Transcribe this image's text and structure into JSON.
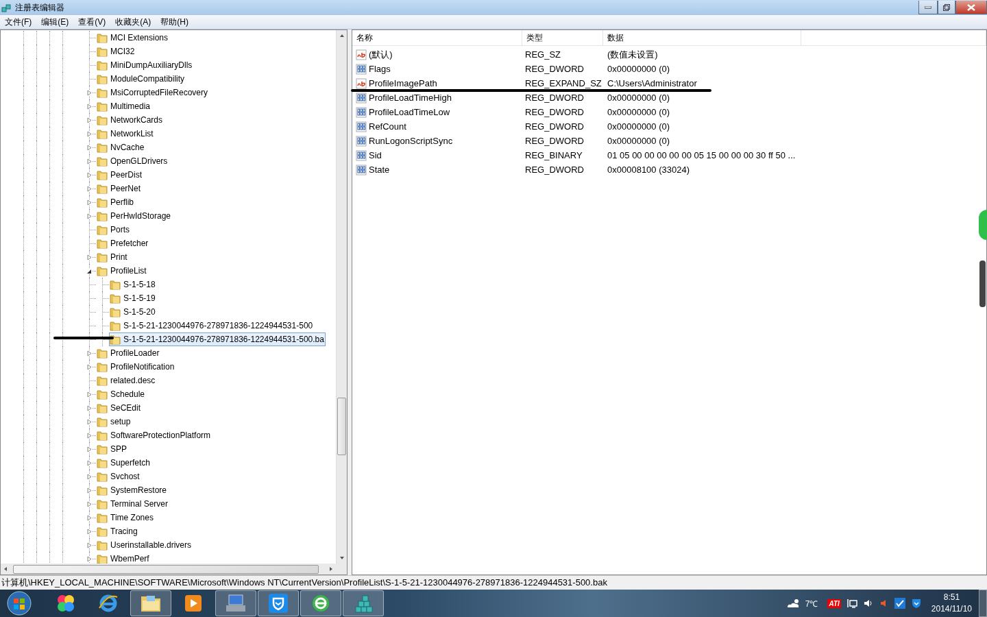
{
  "window": {
    "title": "注册表编辑器"
  },
  "menu": [
    "文件(F)",
    "编辑(E)",
    "查看(V)",
    "收藏夹(A)",
    "帮助(H)"
  ],
  "tree": [
    {
      "label": "MCI Extensions",
      "selected": false
    },
    {
      "label": "MCI32",
      "selected": false
    },
    {
      "label": "MiniDumpAuxiliaryDlls",
      "selected": false
    },
    {
      "label": "ModuleCompatibility",
      "selected": false
    },
    {
      "label": "MsiCorruptedFileRecovery",
      "expanded": false,
      "selected": false
    },
    {
      "label": "Multimedia",
      "expanded": false,
      "selected": false
    },
    {
      "label": "NetworkCards",
      "expanded": false,
      "selected": false
    },
    {
      "label": "NetworkList",
      "expanded": false,
      "selected": false
    },
    {
      "label": "NvCache",
      "expanded": false,
      "selected": false
    },
    {
      "label": "OpenGLDrivers",
      "expanded": false,
      "selected": false
    },
    {
      "label": "PeerDist",
      "expanded": false,
      "selected": false
    },
    {
      "label": "PeerNet",
      "expanded": false,
      "selected": false
    },
    {
      "label": "Perflib",
      "expanded": false,
      "selected": false
    },
    {
      "label": "PerHwIdStorage",
      "expanded": false,
      "selected": false
    },
    {
      "label": "Ports",
      "selected": false
    },
    {
      "label": "Prefetcher",
      "selected": false
    },
    {
      "label": "Print",
      "expanded": false,
      "selected": false
    },
    {
      "label": "ProfileList",
      "expanded": true,
      "selected": false,
      "children": [
        {
          "label": "S-1-5-18",
          "selected": false
        },
        {
          "label": "S-1-5-19",
          "selected": false
        },
        {
          "label": "S-1-5-20",
          "selected": false
        },
        {
          "label": "S-1-5-21-1230044976-278971836-1224944531-500",
          "selected": false
        },
        {
          "label": "S-1-5-21-1230044976-278971836-1224944531-500.ba",
          "selected": true
        }
      ]
    },
    {
      "label": "ProfileLoader",
      "expanded": false,
      "selected": false
    },
    {
      "label": "ProfileNotification",
      "expanded": false,
      "selected": false
    },
    {
      "label": "related.desc",
      "selected": false
    },
    {
      "label": "Schedule",
      "expanded": false,
      "selected": false
    },
    {
      "label": "SeCEdit",
      "expanded": false,
      "selected": false
    },
    {
      "label": "setup",
      "expanded": false,
      "selected": false
    },
    {
      "label": "SoftwareProtectionPlatform",
      "expanded": false,
      "selected": false
    },
    {
      "label": "SPP",
      "expanded": false,
      "selected": false
    },
    {
      "label": "Superfetch",
      "expanded": false,
      "selected": false
    },
    {
      "label": "Svchost",
      "expanded": false,
      "selected": false
    },
    {
      "label": "SystemRestore",
      "expanded": false,
      "selected": false
    },
    {
      "label": "Terminal Server",
      "expanded": false,
      "selected": false
    },
    {
      "label": "Time Zones",
      "expanded": false,
      "selected": false
    },
    {
      "label": "Tracing",
      "expanded": false,
      "selected": false
    },
    {
      "label": "Userinstallable.drivers",
      "expanded": false,
      "selected": false
    },
    {
      "label": "WbemPerf",
      "expanded": false,
      "selected": false
    }
  ],
  "list": {
    "columns": [
      "名称",
      "类型",
      "数据"
    ],
    "rows": [
      {
        "kind": "string",
        "name": "(默认)",
        "type": "REG_SZ",
        "data": "(数值未设置)"
      },
      {
        "kind": "binary",
        "name": "Flags",
        "type": "REG_DWORD",
        "data": "0x00000000 (0)"
      },
      {
        "kind": "string",
        "name": "ProfileImagePath",
        "type": "REG_EXPAND_SZ",
        "data": "C:\\Users\\Administrator"
      },
      {
        "kind": "binary",
        "name": "ProfileLoadTimeHigh",
        "type": "REG_DWORD",
        "data": "0x00000000 (0)"
      },
      {
        "kind": "binary",
        "name": "ProfileLoadTimeLow",
        "type": "REG_DWORD",
        "data": "0x00000000 (0)"
      },
      {
        "kind": "binary",
        "name": "RefCount",
        "type": "REG_DWORD",
        "data": "0x00000000 (0)"
      },
      {
        "kind": "binary",
        "name": "RunLogonScriptSync",
        "type": "REG_DWORD",
        "data": "0x00000000 (0)"
      },
      {
        "kind": "binary",
        "name": "Sid",
        "type": "REG_BINARY",
        "data": "01 05 00 00 00 00 00 05 15 00 00 00 30 ff 50 ..."
      },
      {
        "kind": "binary",
        "name": "State",
        "type": "REG_DWORD",
        "data": "0x00008100 (33024)"
      }
    ]
  },
  "status_bar": "计算机\\HKEY_LOCAL_MACHINE\\SOFTWARE\\Microsoft\\Windows NT\\CurrentVersion\\ProfileList\\S-1-5-21-1230044976-278971836-1224944531-500.bak",
  "taskbar": {
    "apps": [
      {
        "kind": "pinwheel",
        "active": false
      },
      {
        "kind": "browser",
        "active": false
      },
      {
        "kind": "folder",
        "active": true
      },
      {
        "kind": "player",
        "active": false
      },
      {
        "kind": "computer",
        "active": true
      },
      {
        "kind": "shield",
        "active": true
      },
      {
        "kind": "green-browser",
        "active": true
      },
      {
        "kind": "registry",
        "active": true
      }
    ],
    "weather": "7℃",
    "tray_badge": "ATI",
    "time": "8:51",
    "date": "2014/11/10"
  }
}
